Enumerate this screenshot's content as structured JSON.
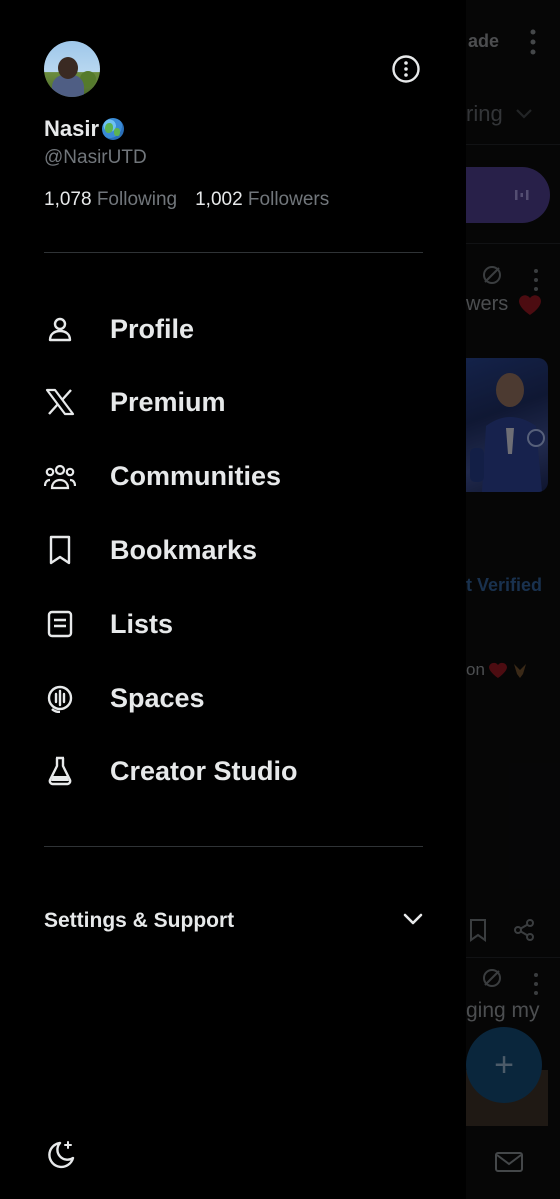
{
  "profile": {
    "display_name": "Nasir",
    "handle": "@NasirUTD",
    "following_count": "1,078",
    "following_label": "Following",
    "followers_count": "1,002",
    "followers_label": "Followers",
    "name_emoji": "globe-icon"
  },
  "menu": {
    "items": [
      {
        "label": "Profile",
        "icon": "person-icon"
      },
      {
        "label": "Premium",
        "icon": "x-logo-icon"
      },
      {
        "label": "Communities",
        "icon": "communities-icon"
      },
      {
        "label": "Bookmarks",
        "icon": "bookmark-icon"
      },
      {
        "label": "Lists",
        "icon": "list-icon"
      },
      {
        "label": "Spaces",
        "icon": "spaces-icon"
      },
      {
        "label": "Creator Studio",
        "icon": "flask-icon"
      }
    ]
  },
  "settings": {
    "label": "Settings & Support"
  },
  "background_timeline": {
    "header_fragment": "ade",
    "tab_fragment": "ring",
    "followers_fragment": "wers",
    "verified_fragment": "t Verified",
    "on_fragment": "on",
    "ging_fragment": "ging my"
  },
  "colors": {
    "background": "#000000",
    "text_primary": "#e7e9ea",
    "text_secondary": "#71767b",
    "divider": "#2f3336",
    "fab": "#1d9bf0",
    "spaces_pill": "#7856ff"
  }
}
